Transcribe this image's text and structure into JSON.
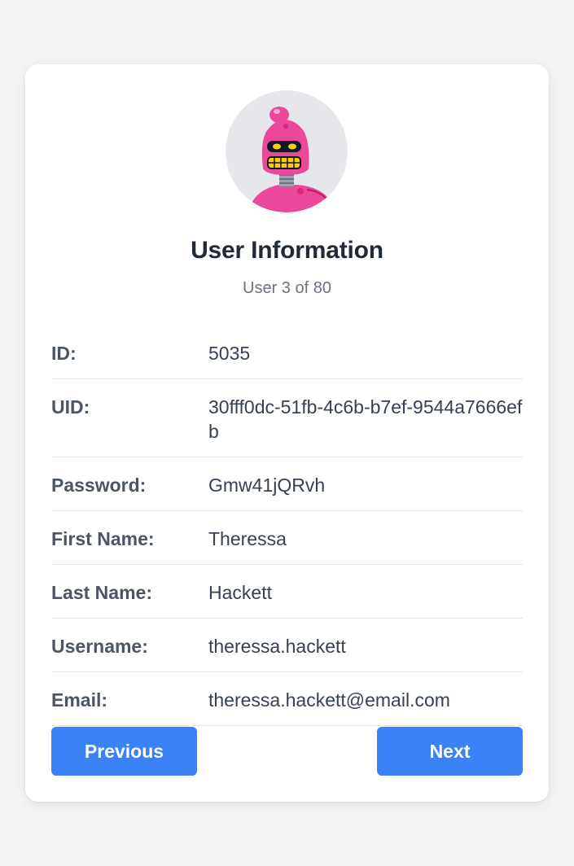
{
  "header": {
    "avatar_icon": "robot-avatar-icon",
    "title": "User Information",
    "subtitle": "User 3 of 80"
  },
  "fields": [
    {
      "label": "ID:",
      "value": "5035"
    },
    {
      "label": "UID:",
      "value": "30fff0dc-51fb-4c6b-b7ef-9544a7666efb"
    },
    {
      "label": "Password:",
      "value": "Gmw41jQRvh"
    },
    {
      "label": "First Name:",
      "value": "Theressa"
    },
    {
      "label": "Last Name:",
      "value": "Hackett"
    },
    {
      "label": "Username:",
      "value": "theressa.hackett"
    },
    {
      "label": "Email:",
      "value": "theressa.hackett@email.com"
    }
  ],
  "buttons": {
    "previous_label": "Previous",
    "next_label": "Next"
  },
  "colors": {
    "accent": "#3b82f6",
    "background": "#f3f4f6",
    "avatar_bg": "#e5e7eb",
    "robot_pink": "#ec4899"
  }
}
